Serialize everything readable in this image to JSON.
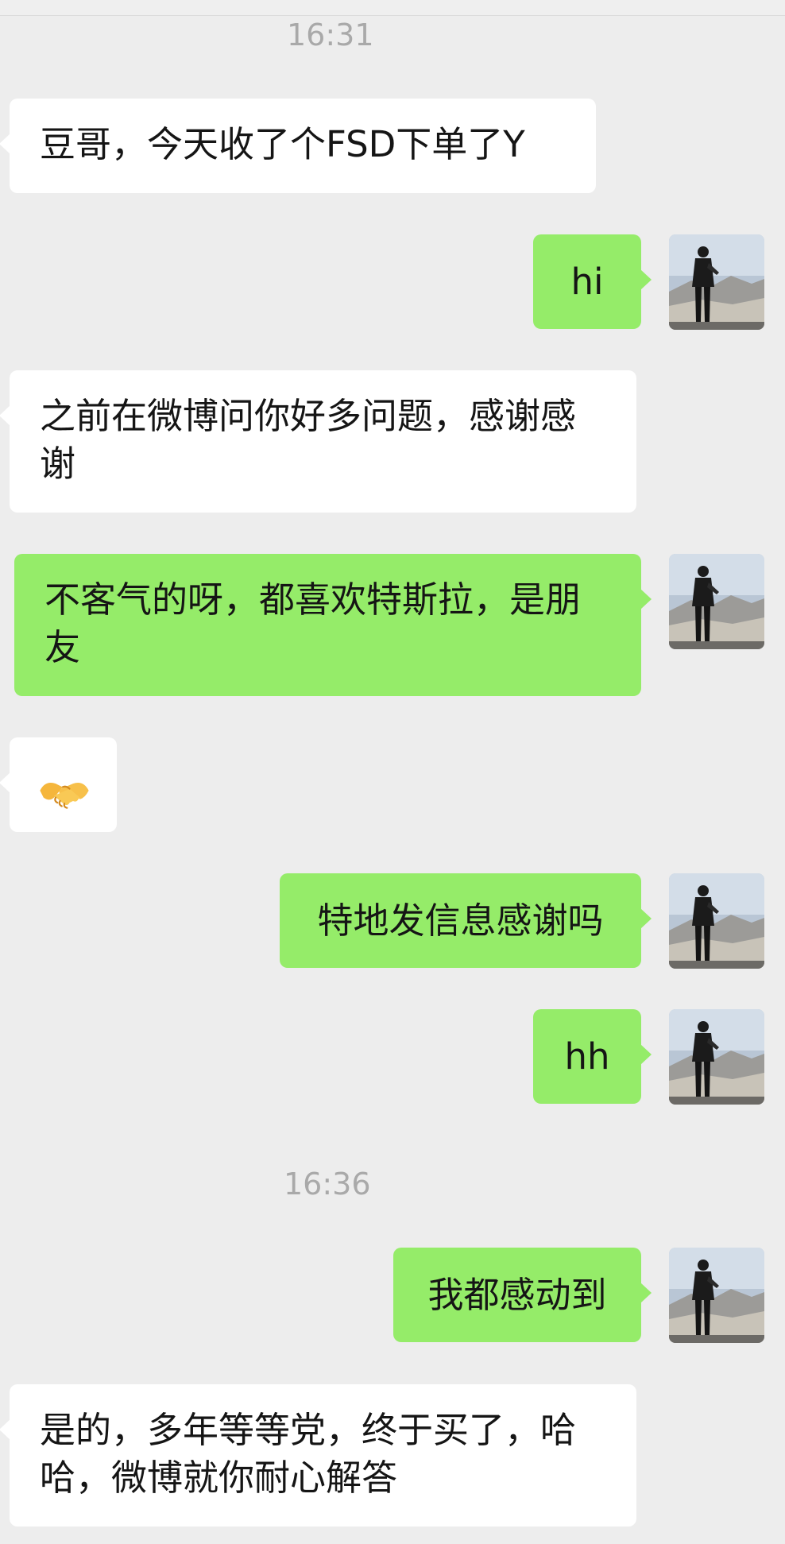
{
  "chat": {
    "timestamps": [
      "16:31",
      "16:36"
    ],
    "messages": [
      {
        "id": 1,
        "side": "incoming",
        "text": "豆哥，今天收了个FSD下单了Y"
      },
      {
        "id": 2,
        "side": "outgoing",
        "text": "hi"
      },
      {
        "id": 3,
        "side": "incoming",
        "text": "之前在微博问你好多问题，感谢感谢"
      },
      {
        "id": 4,
        "side": "outgoing",
        "text": "不客气的呀，都喜欢特斯拉，是朋友"
      },
      {
        "id": 5,
        "side": "incoming",
        "emoji": "handshake-emoji"
      },
      {
        "id": 6,
        "side": "outgoing",
        "text": "特地发信息感谢吗"
      },
      {
        "id": 7,
        "side": "outgoing",
        "text": "hh"
      },
      {
        "id": 8,
        "side": "outgoing",
        "text": "我都感动到"
      },
      {
        "id": 9,
        "side": "incoming",
        "text": "是的，多年等等党，终于买了，哈哈，微博就你耐心解答"
      }
    ]
  },
  "colors": {
    "background": "#ededed",
    "incoming_bubble": "#ffffff",
    "outgoing_bubble": "#95ec69",
    "timestamp_text": "#a9a9a9",
    "message_text": "#151515"
  },
  "icons": {
    "avatar": "user-avatar-photo",
    "emoji": "handshake-emoji"
  }
}
